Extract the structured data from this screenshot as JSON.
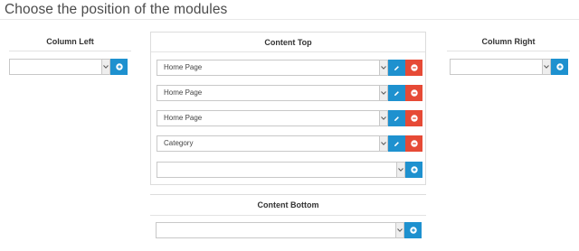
{
  "page": {
    "title": "Choose the position of the modules"
  },
  "column_left": {
    "title": "Column Left",
    "add_row": {
      "value": ""
    }
  },
  "content_top": {
    "title": "Content Top",
    "rows": [
      {
        "value": "Home Page"
      },
      {
        "value": "Home Page"
      },
      {
        "value": "Home Page"
      },
      {
        "value": "Category"
      }
    ],
    "add_row": {
      "value": ""
    }
  },
  "column_right": {
    "title": "Column Right",
    "add_row": {
      "value": ""
    }
  },
  "content_bottom": {
    "title": "Content Bottom",
    "add_row": {
      "value": ""
    }
  },
  "icons": {
    "caret": "chevron-down-icon",
    "edit": "pencil-icon",
    "remove": "minus-circle-icon",
    "add": "plus-circle-icon"
  },
  "colors": {
    "primary": "#1e91cf",
    "danger": "#e64a36",
    "border": "#c8c8c8",
    "caret_bg": "#eeeeee"
  }
}
